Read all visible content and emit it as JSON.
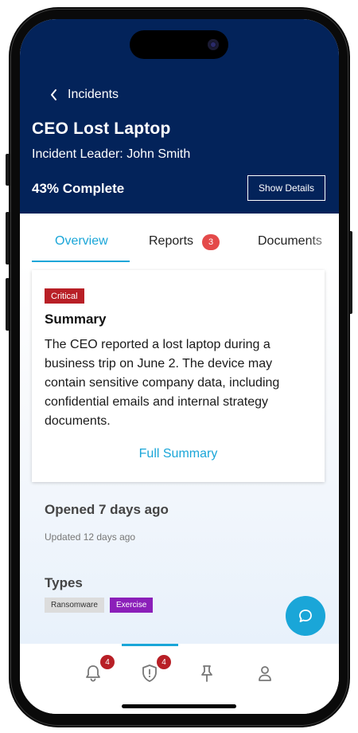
{
  "header": {
    "back_label": "Incidents",
    "title": "CEO Lost Laptop",
    "leader": "Incident Leader: John Smith",
    "progress": "43% Complete",
    "show_details_label": "Show Details"
  },
  "tabs": [
    {
      "label": "Overview",
      "active": true
    },
    {
      "label": "Reports",
      "badge": "3"
    },
    {
      "label": "Documents"
    }
  ],
  "summary_card": {
    "severity": "Critical",
    "heading": "Summary",
    "text": "The CEO reported a lost laptop during a business trip on June 2. The device may contain sensitive company data, including confidential emails and internal strategy documents.",
    "link": "Full Summary"
  },
  "meta": {
    "opened": "Opened 7 days ago",
    "updated": "Updated 12 days ago"
  },
  "types": {
    "heading": "Types",
    "items": [
      "Ransomware",
      "Exercise"
    ]
  },
  "bottom_nav": {
    "items": [
      {
        "icon": "bell-icon",
        "badge": "4"
      },
      {
        "icon": "shield-alert-icon",
        "badge": "4",
        "active": true
      },
      {
        "icon": "pin-icon"
      },
      {
        "icon": "user-icon"
      }
    ]
  },
  "colors": {
    "header_bg": "#03235a",
    "accent": "#1aa6d8",
    "critical": "#b81f26",
    "exercise": "#8b1fb9",
    "badge": "#e44a4a"
  }
}
